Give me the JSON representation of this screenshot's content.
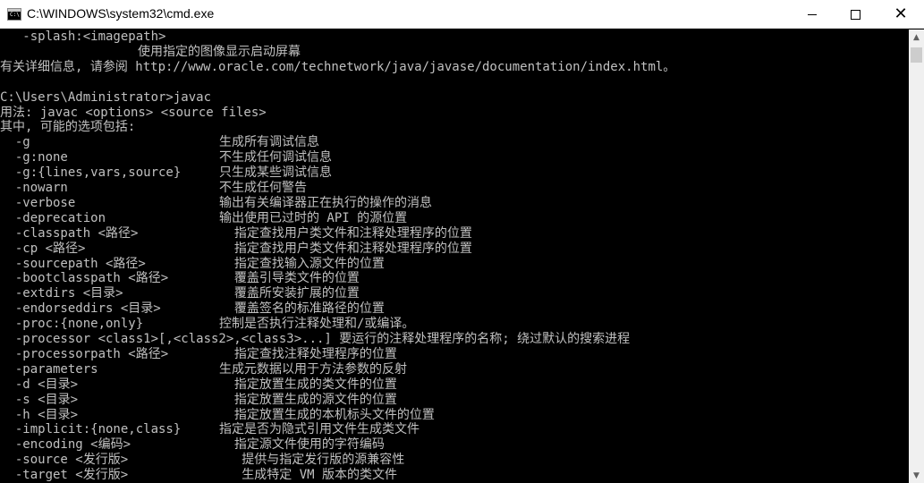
{
  "window": {
    "title": "C:\\WINDOWS\\system32\\cmd.exe"
  },
  "console": {
    "lines": [
      {
        "opt": "   -splash:<imagepath>",
        "desc": ""
      },
      {
        "opt": "",
        "desc": "使用指定的图像显示启动屏幕"
      },
      {
        "opt": "有关详细信息, 请参阅 http://www.oracle.com/technetwork/java/javase/documentation/index.html。",
        "desc": ""
      },
      {
        "opt": "",
        "desc": ""
      },
      {
        "opt": "C:\\Users\\Administrator>javac",
        "desc": ""
      },
      {
        "opt": "用法: javac <options> <source files>",
        "desc": ""
      },
      {
        "opt": "其中, 可能的选项包括:",
        "desc": ""
      },
      {
        "opt": "  -g",
        "desc": "生成所有调试信息"
      },
      {
        "opt": "  -g:none",
        "desc": "不生成任何调试信息"
      },
      {
        "opt": "  -g:{lines,vars,source}",
        "desc": "只生成某些调试信息"
      },
      {
        "opt": "  -nowarn",
        "desc": "不生成任何警告"
      },
      {
        "opt": "  -verbose",
        "desc": "输出有关编译器正在执行的操作的消息"
      },
      {
        "opt": "  -deprecation",
        "desc": "输出使用已过时的 API 的源位置"
      },
      {
        "opt": "  -classpath <路径>",
        "desc": "  指定查找用户类文件和注释处理程序的位置"
      },
      {
        "opt": "  -cp <路径>",
        "desc": "  指定查找用户类文件和注释处理程序的位置"
      },
      {
        "opt": "  -sourcepath <路径>",
        "desc": "  指定查找输入源文件的位置"
      },
      {
        "opt": "  -bootclasspath <路径>",
        "desc": "  覆盖引导类文件的位置"
      },
      {
        "opt": "  -extdirs <目录>",
        "desc": "  覆盖所安装扩展的位置"
      },
      {
        "opt": "  -endorseddirs <目录>",
        "desc": "  覆盖签名的标准路径的位置"
      },
      {
        "opt": "  -proc:{none,only}",
        "desc": "控制是否执行注释处理和/或编译。"
      },
      {
        "opt": "  -processor <class1>[,<class2>,<class3>...] 要运行的注释处理程序的名称; 绕过默认的搜索进程",
        "desc": ""
      },
      {
        "opt": "  -processorpath <路径>",
        "desc": "  指定查找注释处理程序的位置"
      },
      {
        "opt": "  -parameters",
        "desc": "生成元数据以用于方法参数的反射"
      },
      {
        "opt": "  -d <目录>",
        "desc": "  指定放置生成的类文件的位置"
      },
      {
        "opt": "  -s <目录>",
        "desc": "  指定放置生成的源文件的位置"
      },
      {
        "opt": "  -h <目录>",
        "desc": "  指定放置生成的本机标头文件的位置"
      },
      {
        "opt": "  -implicit:{none,class}",
        "desc": "指定是否为隐式引用文件生成类文件"
      },
      {
        "opt": "  -encoding <编码>",
        "desc": "  指定源文件使用的字符编码"
      },
      {
        "opt": "  -source <发行版>",
        "desc": "   提供与指定发行版的源兼容性"
      },
      {
        "opt": "  -target <发行版>",
        "desc": "   生成特定 VM 版本的类文件"
      }
    ]
  },
  "colors": {
    "console_bg": "#000000",
    "console_text": "#c0c0c0",
    "titlebar_bg": "#ffffff"
  }
}
